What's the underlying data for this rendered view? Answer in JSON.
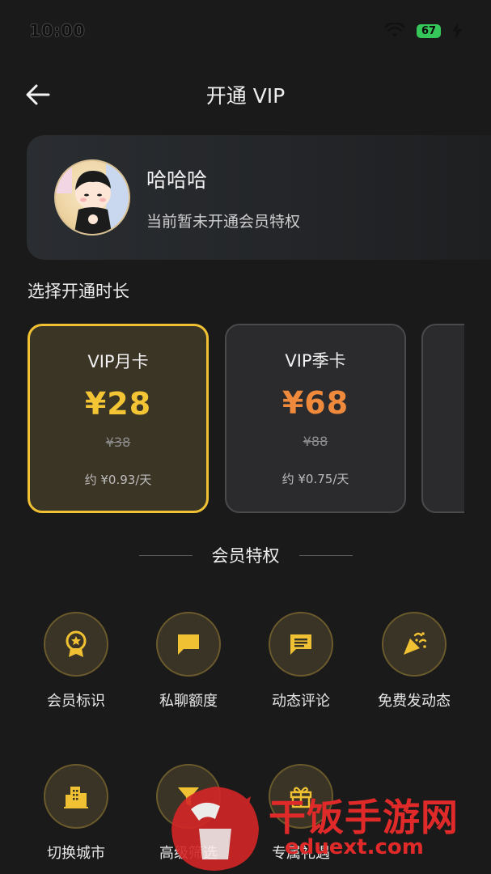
{
  "status_bar": {
    "time": "10:00",
    "battery": "67",
    "icons": [
      "wifi-icon",
      "charging-bolt-icon"
    ]
  },
  "nav": {
    "title": "开通 VIP",
    "back_icon": "arrow-left-icon"
  },
  "profile": {
    "name": "哈哈哈",
    "subtitle": "当前暂未开通会员特权"
  },
  "plans_section": {
    "title": "选择开通时长",
    "plans": [
      {
        "name": "VIP月卡",
        "price": "¥28",
        "original": "¥38",
        "daily": "约 ¥0.93/天",
        "selected": true
      },
      {
        "name": "VIP季卡",
        "price": "¥68",
        "original": "¥88",
        "daily": "约 ¥0.75/天",
        "selected": false
      }
    ]
  },
  "perks_section": {
    "title": "会员特权",
    "items": [
      {
        "label": "会员标识",
        "icon": "badge-icon"
      },
      {
        "label": "私聊额度",
        "icon": "chat-bubble-icon"
      },
      {
        "label": "动态评论",
        "icon": "comment-icon"
      },
      {
        "label": "免费发动态",
        "icon": "party-popper-icon"
      },
      {
        "label": "切换城市",
        "icon": "city-icon"
      },
      {
        "label": "高级筛选",
        "icon": "filter-icon"
      },
      {
        "label": "专属礼遇",
        "icon": "gift-icon"
      }
    ]
  },
  "watermark": {
    "brand": "干饭手游网",
    "url": "eduext.com"
  },
  "colors": {
    "background": "#1a1a1a",
    "accent_gold": "#f3c535",
    "accent_orange": "#ef8a3d",
    "watermark_red": "#e02a2a"
  }
}
